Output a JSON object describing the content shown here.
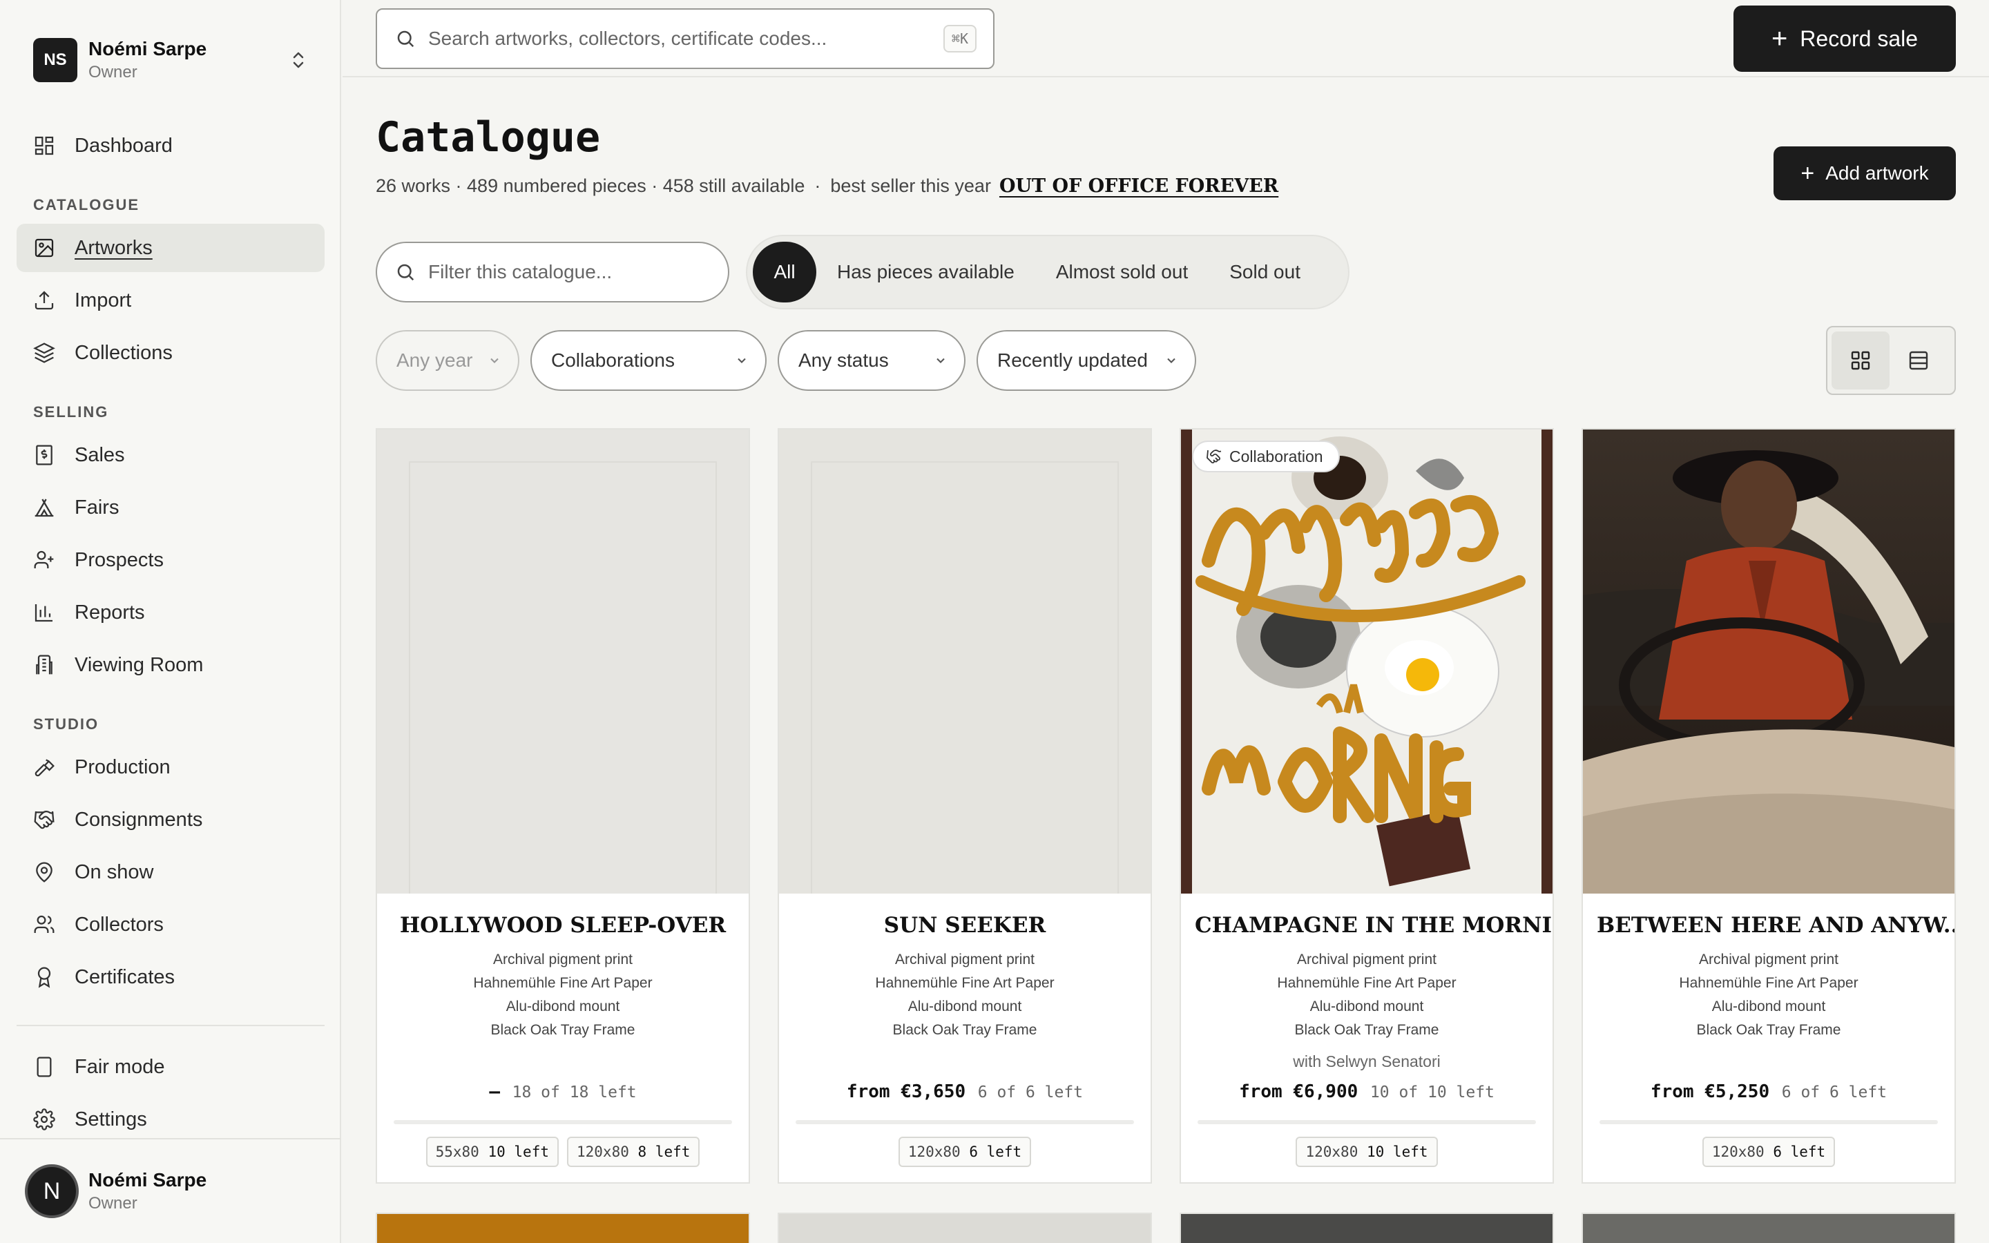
{
  "workspace": {
    "initials": "NS",
    "name": "Noémi Sarpe",
    "role": "Owner"
  },
  "nav": {
    "dashboard": "Dashboard",
    "sections": {
      "catalogue": "CATALOGUE",
      "selling": "SELLING",
      "studio": "STUDIO"
    },
    "artworks": "Artworks",
    "import": "Import",
    "collections": "Collections",
    "sales": "Sales",
    "fairs": "Fairs",
    "prospects": "Prospects",
    "reports": "Reports",
    "viewing_room": "Viewing Room",
    "production": "Production",
    "consignments": "Consignments",
    "on_show": "On show",
    "collectors": "Collectors",
    "certificates": "Certificates",
    "fair_mode": "Fair mode",
    "settings": "Settings"
  },
  "user": {
    "initial": "N",
    "name": "Noémi Sarpe",
    "role": "Owner"
  },
  "topbar": {
    "search_placeholder": "Search artworks, collectors, certificate codes...",
    "shortcut": "⌘K",
    "record_sale": "Record sale"
  },
  "header": {
    "title": "Catalogue",
    "summary": "26 works · 489 numbered pieces · 458 still available",
    "separator": "·",
    "bestseller_label": "best seller this year",
    "bestseller_title": "OUT OF OFFICE FOREVER",
    "add_artwork": "Add artwork"
  },
  "filters": {
    "search_placeholder": "Filter this catalogue...",
    "segments": [
      "All",
      "Has pieces available",
      "Almost sold out",
      "Sold out"
    ],
    "active_segment": "All",
    "year": "Any year",
    "collab": "Collaborations",
    "status": "Any status",
    "sort": "Recently updated"
  },
  "colors": {
    "accent": "#1c1c1c",
    "active_nav": "#e6e7e2",
    "background": "#f5f5f2"
  },
  "cards": [
    {
      "title": "HOLLYWOOD SLEEP-OVER",
      "specs": [
        "Archival pigment print",
        "Hahnemühle Fine Art Paper",
        "Alu-dibond mount",
        "Black Oak Tray Frame"
      ],
      "price": "—",
      "left": "18 of 18 left",
      "variants": [
        {
          "size": "55x80",
          "left": "10 left"
        },
        {
          "size": "120x80",
          "left": "8 left"
        }
      ]
    },
    {
      "title": "SUN SEEKER",
      "specs": [
        "Archival pigment print",
        "Hahnemühle Fine Art Paper",
        "Alu-dibond mount",
        "Black Oak Tray Frame"
      ],
      "price": "from €3,650",
      "left": "6 of 6 left",
      "variants": [
        {
          "size": "120x80",
          "left": "6 left"
        }
      ]
    },
    {
      "title": "CHAMPAGNE IN THE MORNI...",
      "badge": "Collaboration",
      "specs": [
        "Archival pigment print",
        "Hahnemühle Fine Art Paper",
        "Alu-dibond mount",
        "Black Oak Tray Frame"
      ],
      "collaborator": "with Selwyn Senatori",
      "price": "from €6,900",
      "left": "10 of 10 left",
      "variants": [
        {
          "size": "120x80",
          "left": "10 left"
        }
      ]
    },
    {
      "title": "BETWEEN HERE AND ANYW...",
      "specs": [
        "Archival pigment print",
        "Hahnemühle Fine Art Paper",
        "Alu-dibond mount",
        "Black Oak Tray Frame"
      ],
      "price": "from €5,250",
      "left": "6 of 6 left",
      "variants": [
        {
          "size": "120x80",
          "left": "6 left"
        }
      ]
    }
  ]
}
